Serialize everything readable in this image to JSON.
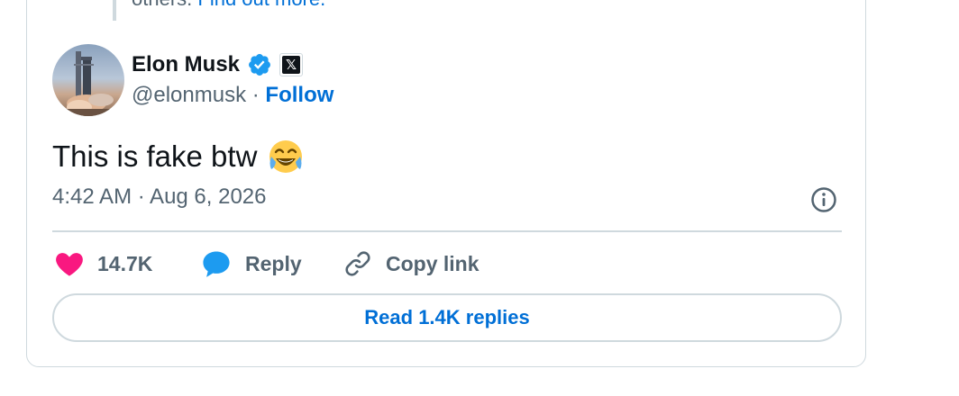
{
  "context": {
    "text_partial": "others.",
    "link_partial": "Find out more."
  },
  "author": {
    "name": "Elon Musk",
    "handle": "@elonmusk",
    "separator": "·",
    "follow_label": "Follow",
    "verified_icon": "verified-badge-icon",
    "affiliation_icon": "x-logo-icon"
  },
  "tweet": {
    "text": "This is fake btw",
    "emoji": "face-with-tears-of-joy-icon",
    "timestamp": "4:42 AM · Aug 6, 2026"
  },
  "actions": {
    "like_count": "14.7K",
    "reply_label": "Reply",
    "copy_label": "Copy link"
  },
  "read_replies_label": "Read 1.4K replies",
  "colors": {
    "link": "#006fd6",
    "verified": "#1d9bf0",
    "like": "#f91880",
    "muted_text": "#536471",
    "border": "#cfd9de"
  }
}
